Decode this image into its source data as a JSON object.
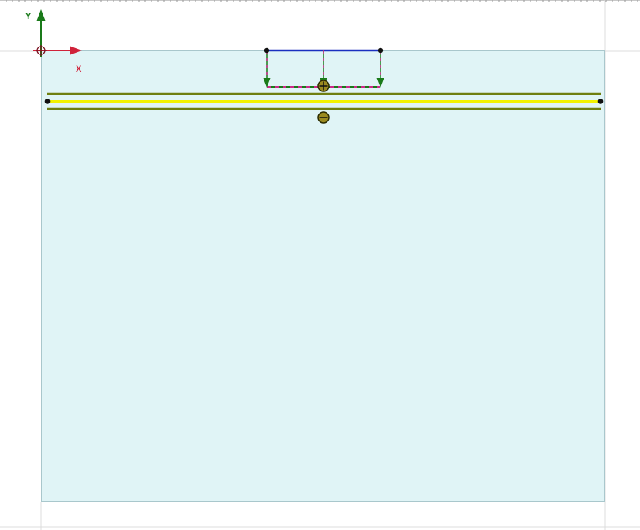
{
  "axes": {
    "x_label": "X",
    "y_label": "Y"
  },
  "colors": {
    "background": "#ffffff",
    "soil_fill": "#e0f4f6",
    "soil_border": "#a9c7cc",
    "grid_line": "#d0d0d0",
    "ruler_tick": "#9a9a9a",
    "x_axis": "#d0223a",
    "y_axis": "#1a7a1a",
    "load_line": "#1a2fc0",
    "load_arrow": "#1a7a1a",
    "load_dash": "#cc2a8a",
    "beam_outer": "#6f7f10",
    "beam_inner": "#f2f200",
    "node": "#111111",
    "marker_fill": "#9a8a20",
    "marker_stroke": "#2a2a00"
  },
  "model": {
    "load_arrow_count": 3,
    "beam_end_nodes": 2,
    "load_end_nodes": 2,
    "markers": [
      {
        "sign": "plus"
      },
      {
        "sign": "minus"
      }
    ]
  }
}
